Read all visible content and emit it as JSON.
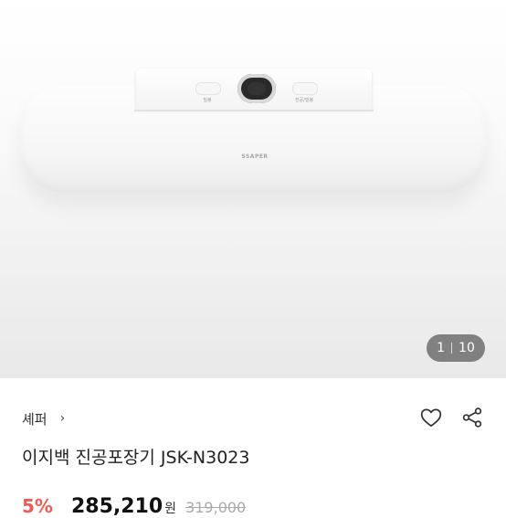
{
  "gallery": {
    "current_page": "1",
    "total_pages": "10"
  },
  "product_image": {
    "lid_label_left": "밀봉",
    "lid_label_right": "진공/밀봉",
    "brand_mark": "SSAPER"
  },
  "store": {
    "name": "셰퍼",
    "chevron": "›"
  },
  "product": {
    "title": "이지백 진공포장기 JSK-N3023"
  },
  "price": {
    "discount": "5%",
    "sale": "285,210",
    "currency": "원",
    "original": "319,000"
  },
  "icons": {
    "wishlist": "heart-icon",
    "share": "share-icon",
    "store_link": "chevron-right-icon"
  },
  "colors": {
    "discount": "#ef5b55",
    "counter_bg": "rgba(0,0,0,0.45)"
  }
}
